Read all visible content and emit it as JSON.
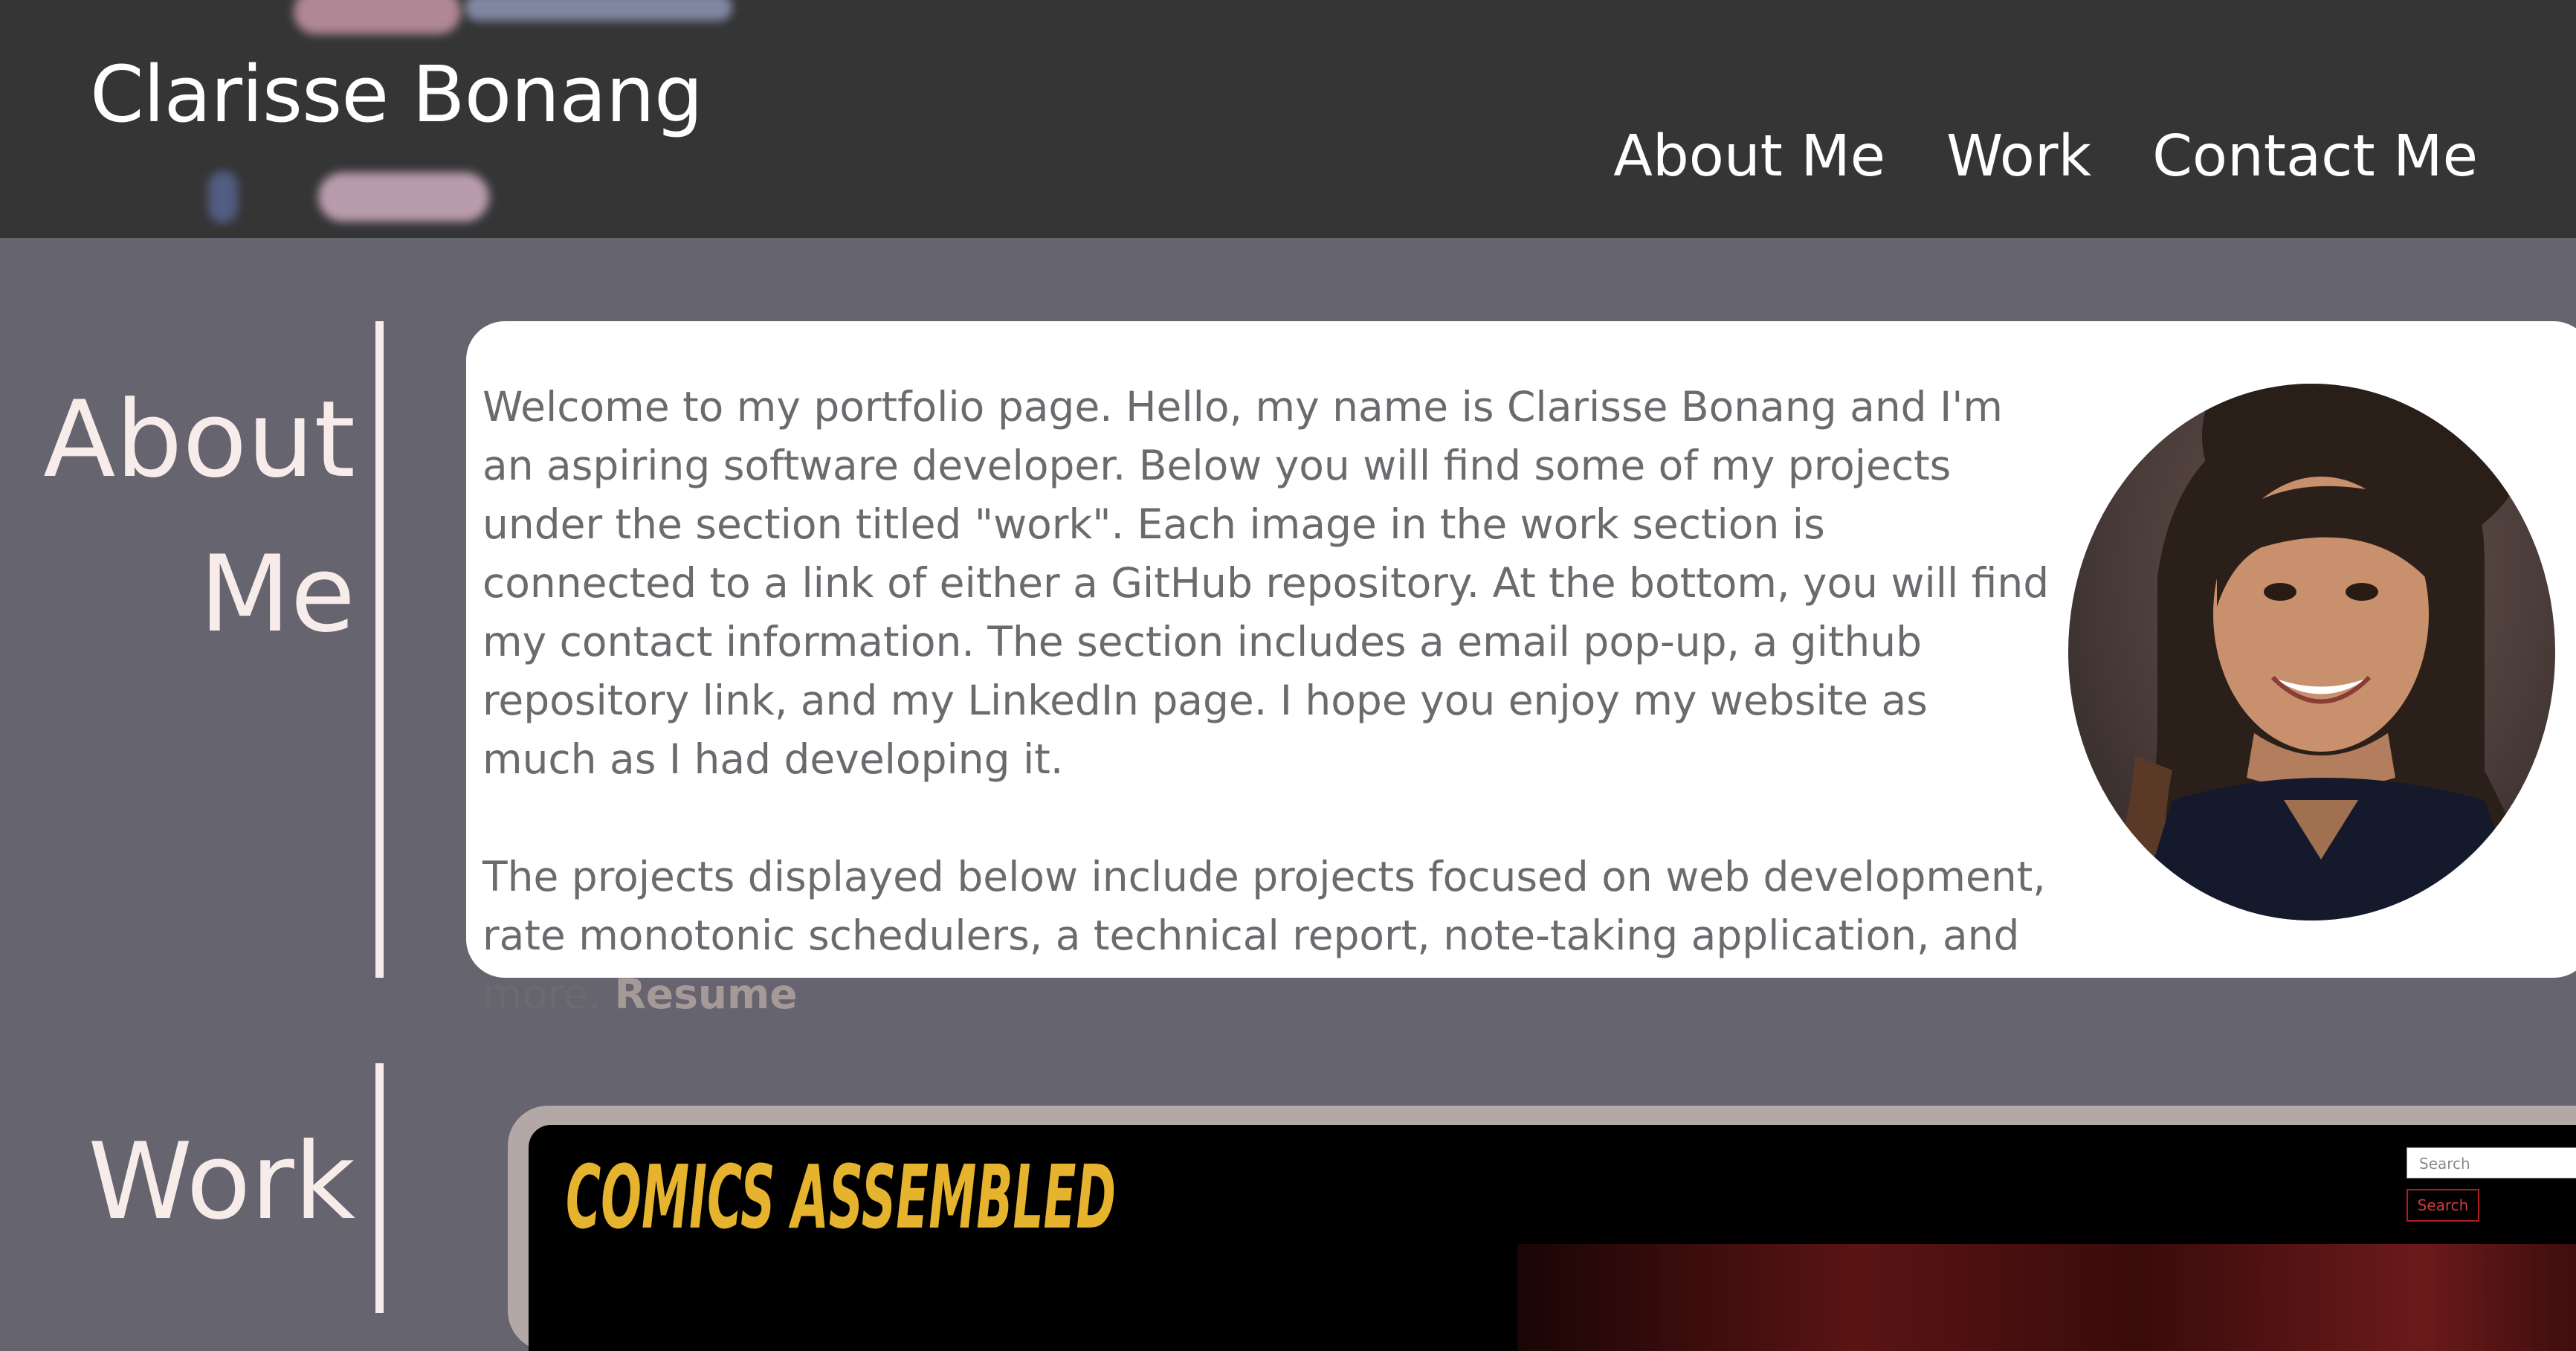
{
  "header": {
    "site_name": "Clarisse Bonang",
    "nav": [
      "About Me",
      "Work",
      "Contact Me"
    ]
  },
  "about": {
    "title_line1": "About",
    "title_line2": "Me",
    "paragraph1": "Welcome to my portfolio page. Hello, my name is Clarisse Bonang and I'm an aspiring software developer. Below you will find some of my projects under the section titled \"work\". Each image in the work section is connected to a link of either a GitHub repository. At the bottom, you will find my contact information. The section includes a email pop-up, a github repository link, and my LinkedIn page. I hope you enjoy my website as much as I had developing it.",
    "paragraph2": "The projects displayed below include projects focused on web development, rate monotonic schedulers, a technical report, note-taking application, and more.",
    "resume_label": "Resume"
  },
  "work": {
    "title": "Work",
    "preview": {
      "logo_text": "COMICS ASSEMBLED",
      "search_placeholder": "Search",
      "search_button": "Search"
    }
  },
  "colors": {
    "header_bg": "#353536",
    "page_bg": "#66646f",
    "accent_text": "#f7ecea",
    "resume_link": "#a59a97",
    "logo_yellow": "#e6b32f"
  }
}
